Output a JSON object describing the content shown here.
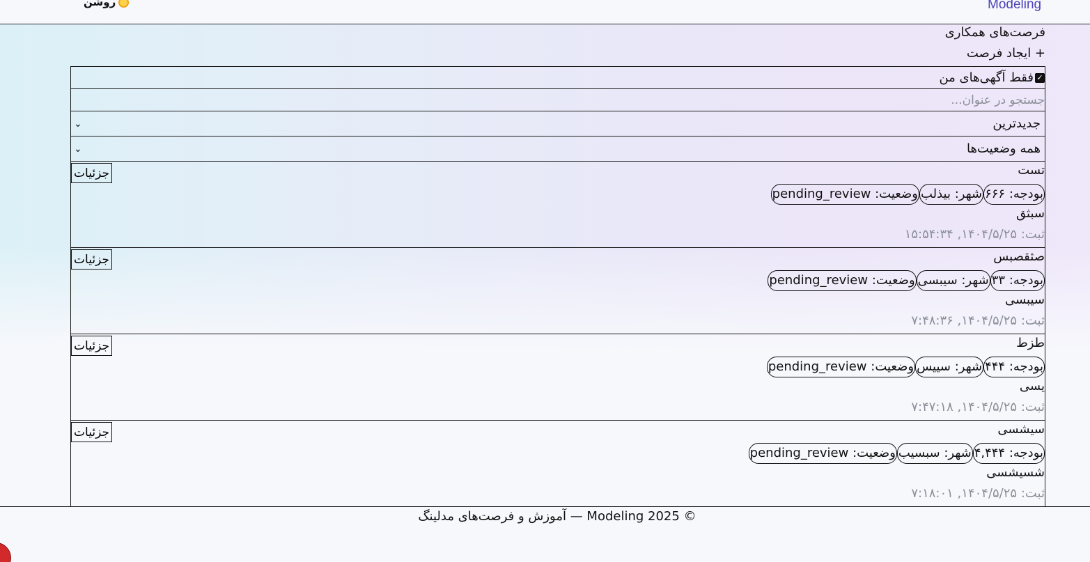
{
  "header": {
    "brand": "Modeling",
    "theme_label": "روشن",
    "theme_icon": "sun-icon"
  },
  "main": {
    "title": "فرصت‌های همکاری",
    "create_label": "+ ایجاد فرصت",
    "filters": {
      "only_mine_label": "فقط آگهی‌های من",
      "only_mine_checked": true,
      "search_placeholder": "جستجو در عنوان...",
      "search_value": "",
      "sort_value": "جدیدترین",
      "status_value": "همه وضعیت‌ها"
    },
    "details_label": "جزئیات",
    "items": [
      {
        "title": "تست",
        "budget": "بودجه: ۶۶۶",
        "city": "شهر: بیذلب",
        "status": "وضعیت: pending_review",
        "desc": "سبثق",
        "date": "ثبت: ۱۴۰۴/۵/۲۵, ۱۵:۵۴:۳۴"
      },
      {
        "title": "صثقصبس",
        "budget": "بودجه: ۳۳",
        "city": "شهر: سیبسی",
        "status": "وضعیت: pending_review",
        "desc": "سیبسی",
        "date": "ثبت: ۱۴۰۴/۵/۲۵, ۷:۴۸:۳۶"
      },
      {
        "title": "طزط",
        "budget": "بودجه: ۴۴۴",
        "city": "شهر: سییس",
        "status": "وضعیت: pending_review",
        "desc": "یسی",
        "date": "ثبت: ۱۴۰۴/۵/۲۵, ۷:۴۷:۱۸"
      },
      {
        "title": "سیشسی",
        "budget": "بودجه: ۴,۴۴۴",
        "city": "شهر: سبسیب",
        "status": "وضعیت: pending_review",
        "desc": "شسیشسی",
        "date": "ثبت: ۱۴۰۴/۵/۲۵, ۷:۱۸:۰۱"
      }
    ]
  },
  "footer": {
    "text": "© Modeling 2025 — آموزش و فرصت‌های مدلینگ"
  },
  "colors": {
    "brand": "#4b43b8",
    "muted_text": "#8a8f98",
    "fab": "#d22a2a"
  }
}
